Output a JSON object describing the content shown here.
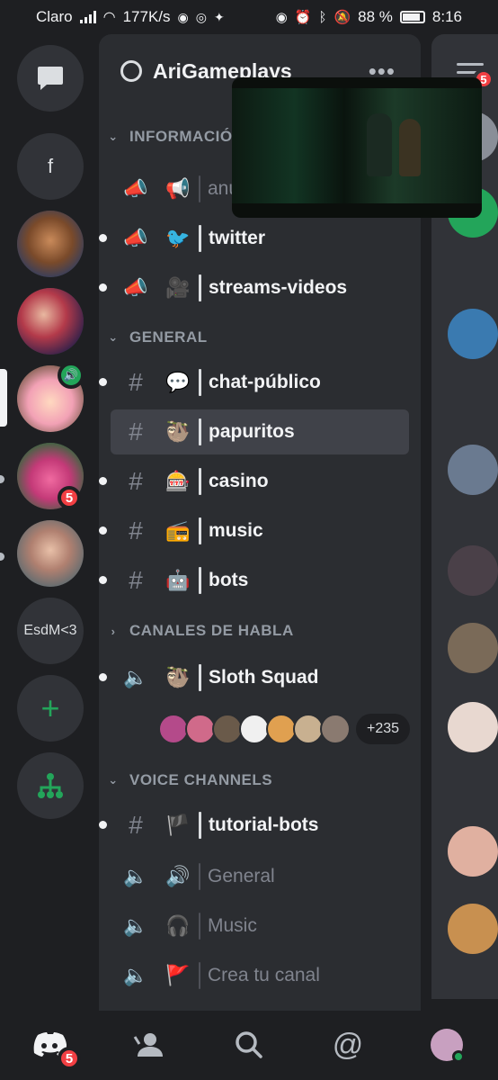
{
  "status_bar": {
    "carrier": "Claro",
    "speed": "177K/s",
    "battery": "88 %",
    "time": "8:16"
  },
  "server": {
    "name": "AriGameplays",
    "menu": "•••"
  },
  "rail": {
    "folder_letter": "f",
    "esdm_label": "EsdM<3",
    "badges": [
      "5"
    ],
    "add_label": "+"
  },
  "categories": {
    "informacion": "INFORMACIÓ",
    "general": "GENERAL",
    "canales_habla": "CANALES DE HABLA",
    "voice_channels": "VOICE CHANNELS"
  },
  "channels": [
    {
      "name": "anu",
      "emoji": "📢"
    },
    {
      "name": "twitter",
      "emoji": "🐦"
    },
    {
      "name": "streams-videos",
      "emoji": "🎥"
    },
    {
      "name": "chat-público",
      "emoji": "💬"
    },
    {
      "name": "papuritos",
      "emoji": "🦥"
    },
    {
      "name": "casino",
      "emoji": "🎰"
    },
    {
      "name": "music",
      "emoji": "📻"
    },
    {
      "name": "bots",
      "emoji": "🤖"
    },
    {
      "name": "Sloth Squad",
      "emoji": "🦥"
    },
    {
      "name": "tutorial-bots",
      "emoji": "🏴"
    },
    {
      "name": "General",
      "emoji": "🔊"
    },
    {
      "name": "Music",
      "emoji": "🎧"
    },
    {
      "name": "Crea tu canal",
      "emoji": "🚩"
    }
  ],
  "voice_users_more": "+235",
  "right_badge": "5",
  "nav_badge": "5",
  "colors": {
    "background": "#1e1f22",
    "panel": "#2b2d31",
    "selected": "#404249",
    "green": "#23a55a",
    "red": "#f23f43"
  }
}
